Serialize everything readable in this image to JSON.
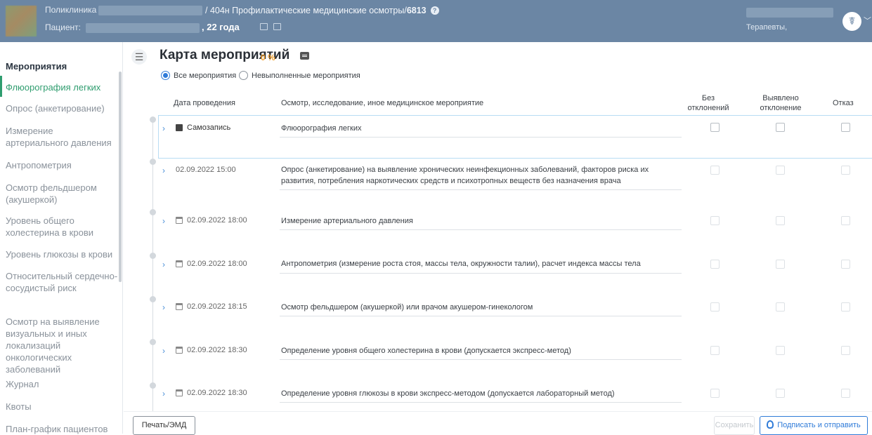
{
  "header": {
    "clinic_label": "Поликлиника",
    "patient_label": "Пациент:",
    "title_prefix": "/ 404н Профилактические медицинские осмотры/",
    "title_number": "6813",
    "help": "?",
    "age": ", 22 года",
    "role": "Терапевты,",
    "avatar_glyph": "☤",
    "chevron": "﹀"
  },
  "sidebar": {
    "title": "Мероприятия",
    "items": [
      "Флюорография легких",
      "Опрос (анкетирование)",
      "Измерение артериального давления",
      "Антропометрия",
      "Осмотр фельдшером (акушеркой)",
      "Уровень общего холестерина в крови",
      "Уровень глюкозы в крови",
      "Относительный сердечно-сосудистый риск",
      "Осмотр на выявление визуальных и иных локализаций онкологических заболеваний",
      "Журнал",
      "Квоты",
      "План-график пациентов"
    ],
    "active_index": 0
  },
  "main": {
    "menu_glyph": "☰",
    "title": "Карта мероприятий",
    "percent": "0 %",
    "filters": {
      "all": "Все мероприятия",
      "pending": "Невыполненные мероприятия",
      "selected": "all"
    },
    "columns": {
      "date": "Дата проведения",
      "event": "Осмотр, исследование, иное медицинское мероприятие",
      "no_dev": "Без отклонений",
      "dev": "Выявлено отклонение",
      "refusal": "Отказ"
    },
    "rows": [
      {
        "date": "Самозапись",
        "event": "Флюорография легких"
      },
      {
        "date": "02.09.2022 15:00",
        "event": "Опрос (анкетирование) на выявление хронических неинфекционных заболеваний, факторов риска их развития, потребления наркотических средств и психотропных веществ без назначения врача"
      },
      {
        "date": "02.09.2022 18:00",
        "event": "Измерение артериального давления"
      },
      {
        "date": "02.09.2022 18:00",
        "event": "Антропометрия (измерение роста стоя, массы тела, окружности талии), расчет индекса массы тела"
      },
      {
        "date": "02.09.2022 18:15",
        "event": "Осмотр фельдшером (акушеркой) или врачом акушером-гинекологом"
      },
      {
        "date": "02.09.2022 18:30",
        "event": "Определение уровня общего холестерина в крови (допускается экспресс-метод)"
      },
      {
        "date": "02.09.2022 18:30",
        "event": "Определение уровня глюкозы в крови экспресс-методом (допускается лабораторный метод)"
      }
    ],
    "chevron": "›"
  },
  "footer": {
    "print": "Печать/ЭМД",
    "save": "Сохранить",
    "sign": "Подписать и отправить"
  }
}
